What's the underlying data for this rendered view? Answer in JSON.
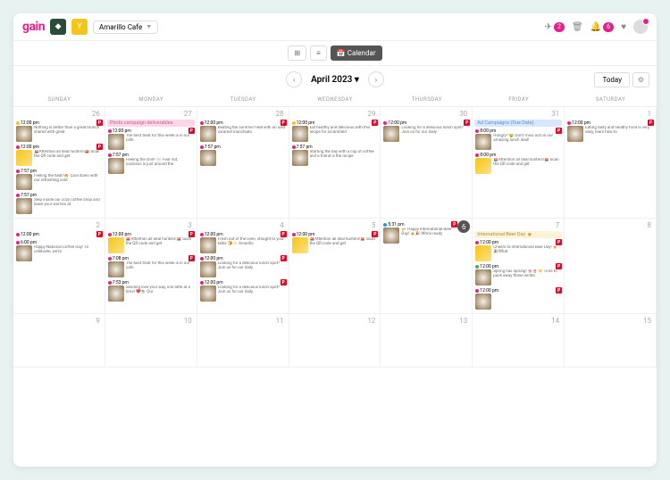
{
  "header": {
    "logo": "gain",
    "brand": "Amarillo Cafe",
    "send_badge": "2",
    "bell_badge": "6"
  },
  "viewbar": {
    "grid": "⊞",
    "list": "≡",
    "calendar": "📅 Calendar"
  },
  "nav": {
    "month": "April 2023",
    "today": "Today"
  },
  "days": [
    "SUNDAY",
    "MONDAY",
    "TUESDAY",
    "WEDNESDAY",
    "THURSDAY",
    "FRIDAY",
    "SATURDAY"
  ],
  "banners": {
    "photo": "Photo campaign deliverables",
    "ad": "Ad Campaigns (Due Date)",
    "beer": "International Beer Day 🍺"
  },
  "weeks": [
    {
      "cells": [
        {
          "num": "26",
          "events": [
            {
              "dot": "y",
              "time": "12:00 pm",
              "text": "Nothing is better than a great brunch shared with great",
              "pin": true,
              "thumb": "c"
            },
            {
              "dot": "p",
              "time": "12:00 pm",
              "text": "🚨Attention all deal hunters!🚨 Scan the QR code and get",
              "pin": true,
              "thumb": "y"
            },
            {
              "dot": "p",
              "time": "7:57 pm",
              "text": "Feeling the heat?🔥 Cool down with our refreshing cold",
              "thumb": "c"
            },
            {
              "dot": "p",
              "time": "7:57 pm",
              "text": "Step inside our cozy coffee shop and leave your worries at",
              "thumb": "c"
            }
          ]
        },
        {
          "num": "27",
          "banner": "photo",
          "events": [
            {
              "dot": "p",
              "time": "12:00 pm",
              "text": "The best treat for this week is in our cafe",
              "pin": true,
              "thumb": "c"
            },
            {
              "dot": "p",
              "time": "7:57 pm",
              "text": "Feeling the chill? ❄️ Fear not, coziness is just around the",
              "thumb": "c"
            }
          ]
        },
        {
          "num": "28",
          "events": [
            {
              "dot": "p",
              "time": "12:00 pm",
              "text": "Beating the summer heat with an iced caramel macchiato",
              "pin": true,
              "thumb": "c"
            },
            {
              "dot": "p",
              "time": "7:57 pm",
              "text": "",
              "thumb": "c"
            }
          ]
        },
        {
          "num": "29",
          "events": [
            {
              "dot": "y",
              "time": "12:00 pm",
              "text": "Eat healthy and delicious with this recipe for scrambled",
              "pin": true,
              "thumb": "c"
            },
            {
              "dot": "p",
              "time": "7:57 pm",
              "text": "Starting the day with a cup of coffee and a friend is the recipe",
              "thumb": "c"
            }
          ]
        },
        {
          "num": "30",
          "events": [
            {
              "dot": "p",
              "time": "12:00 pm",
              "text": "Looking for a delicious lunch spot? Join us for our daily",
              "pin": true,
              "thumb": "c"
            }
          ]
        },
        {
          "num": "31",
          "banner": "ad",
          "events": [
            {
              "dot": "p",
              "time": "8:00 pm",
              "text": "Hungry? 🤤 Don't miss out on our amazing lunch deal!",
              "pin": true,
              "thumb": "c"
            },
            {
              "dot": "p",
              "time": "8:00 pm",
              "text": "🚨Attention all deal hunters!🚨 Scan the QR code and get",
              "thumb": "y"
            }
          ]
        },
        {
          "num": "1",
          "events": [
            {
              "dot": "p",
              "time": "12:00 pm",
              "text": "Eating tasty and healthy food is very easy, learn how to",
              "pin": true,
              "thumb": "c"
            }
          ]
        }
      ]
    },
    {
      "cells": [
        {
          "num": "2",
          "events": [
            {
              "dot": "p",
              "time": "12:00 pm",
              "text": "",
              "pin": true
            },
            {
              "dot": "p",
              "time": "6:00 pm",
              "text": "Happy National Coffee Day! To celebrate, we're",
              "thumb": "c"
            }
          ]
        },
        {
          "num": "3",
          "events": [
            {
              "dot": "p",
              "time": "12:00 pm",
              "text": "🚨Attention all deal hunters!🚨 Scan the QR code and get",
              "pin": true,
              "thumb": "y"
            },
            {
              "dot": "p",
              "time": "7:08 pm",
              "text": "The best treat for this week is in our cafe",
              "pin": true,
              "thumb": "c"
            },
            {
              "dot": "p",
              "time": "7:53 pm",
              "text": "Sending love your way, one latte at a time! ❤️☕ Our",
              "thumb": "c"
            }
          ]
        },
        {
          "num": "4",
          "events": [
            {
              "dot": "p",
              "time": "12:00 pm",
              "text": "Fresh out of the oven, straight to your table 🍞✨ Amarillo",
              "pin": true,
              "thumb": "c"
            },
            {
              "dot": "p",
              "time": "12:00 pm",
              "text": "Looking for a delicious lunch spot? Join us for our daily",
              "pin": true,
              "thumb": "c"
            },
            {
              "dot": "p",
              "time": "12:00 pm",
              "text": "Looking for a delicious lunch spot? Join us for our daily",
              "pin": true,
              "thumb": "c"
            }
          ]
        },
        {
          "num": "5",
          "events": [
            {
              "dot": "p",
              "time": "12:00 pm",
              "text": "🚨Attention all deal hunters!🚨 Scan the QR code and get",
              "pin": true,
              "thumb": "y"
            }
          ]
        },
        {
          "num": "6",
          "today": true,
          "events": [
            {
              "dot": "b",
              "time": "5:31 pm",
              "text": "🍻 Happy International Beer Day! 🍺🎉 Who's ready",
              "pin": true,
              "thumb": "c"
            }
          ]
        },
        {
          "num": "7",
          "banner": "beer",
          "events": [
            {
              "dot": "p",
              "time": "12:00 pm",
              "text": "Cheers to International Beer Day! 🍺🎉What",
              "pin": true,
              "thumb": "y"
            },
            {
              "dot": "g",
              "time": "12:00 pm",
              "text": "Spring has sprung! 🌸🌷☀️ Time to pack away those winter",
              "pin": true,
              "thumb": "c"
            },
            {
              "dot": "p",
              "time": "12:00 pm",
              "text": "",
              "pin": true,
              "thumb": "c"
            }
          ]
        },
        {
          "num": "8",
          "events": []
        }
      ]
    },
    {
      "cells": [
        {
          "num": "9"
        },
        {
          "num": "10"
        },
        {
          "num": "11"
        },
        {
          "num": "12"
        },
        {
          "num": "13"
        },
        {
          "num": "14"
        },
        {
          "num": "15"
        }
      ]
    }
  ]
}
